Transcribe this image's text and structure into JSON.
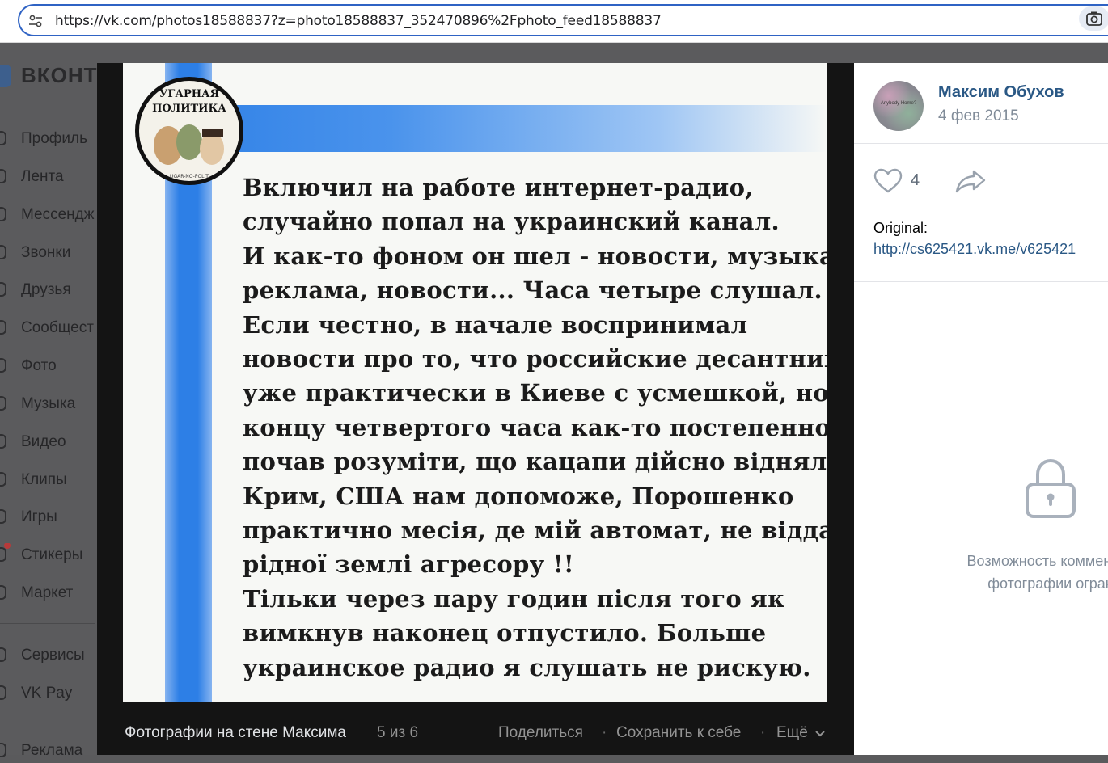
{
  "browser": {
    "url": "https://vk.com/photos18588837?z=photo18588837_352470896%2Fphoto_feed18588837"
  },
  "vk": {
    "logo_text": "ВКОНТ",
    "sidebar": [
      {
        "label": "Профиль",
        "icon": "profile-icon"
      },
      {
        "label": "Лента",
        "icon": "feed-icon"
      },
      {
        "label": "Мессендж",
        "icon": "messenger-icon"
      },
      {
        "label": "Звонки",
        "icon": "calls-icon"
      },
      {
        "label": "Друзья",
        "icon": "friends-icon"
      },
      {
        "label": "Сообщест",
        "icon": "communities-icon"
      },
      {
        "label": "Фото",
        "icon": "photos-icon"
      },
      {
        "label": "Музыка",
        "icon": "music-icon"
      },
      {
        "label": "Видео",
        "icon": "video-icon"
      },
      {
        "label": "Клипы",
        "icon": "clips-icon"
      },
      {
        "label": "Игры",
        "icon": "games-icon"
      },
      {
        "label": "Стикеры",
        "icon": "stickers-icon"
      },
      {
        "label": "Маркет",
        "icon": "market-icon"
      },
      {
        "label": "Сервисы",
        "icon": "services-icon"
      },
      {
        "label": "VK Pay",
        "icon": "vkpay-icon"
      },
      {
        "label": "Реклама",
        "icon": "ads-icon"
      }
    ]
  },
  "photo": {
    "badge_line1": "УГАРНАЯ",
    "badge_line2": "ПОЛИТИКА",
    "badge_line3": "UGAR-NO-POLIT",
    "lines": [
      "Включил на работе интернет-радио,",
      "случайно попал на украинский канал.",
      "И как-то фоном он шел - новости, музыка,",
      "реклама, новости... Часа четыре слушал.",
      "Если честно, в начале воспринимал",
      "новости про то, что российские десантники",
      "уже практически в Киеве с усмешкой, но к",
      "концу четвертого часа как-то постепенно",
      "почав розуміти, що кацапи дійсно відняли",
      "Крим, США нам допоможе, Порошенко",
      "практично месія, де мій автомат, не віддам",
      "рідної землі агресору !!",
      "Тільки через пару годин після того як",
      "вимкнув наконец отпустило. Больше",
      "украинское радио я слушать не рискую."
    ]
  },
  "viewer": {
    "album": "Фотографии на стене Максима",
    "counter": "5 из 6",
    "share": "Поделиться",
    "save": "Сохранить к себе",
    "more": "Ещё",
    "dot": "·"
  },
  "panel": {
    "avatar_text": "Anybody Home?",
    "author": "Максим Обухов",
    "date": "4 фев 2015",
    "likes": "4",
    "original_label": "Original:",
    "original_link": "http://cs625421.vk.me/v625421",
    "comments_closed_line1": "Возможность комментиро",
    "comments_closed_line2": "фотографии ограни"
  },
  "colors": {
    "vk_link": "#2a5885",
    "muted": "#818c99",
    "accent_blue": "#2d7fe6"
  }
}
